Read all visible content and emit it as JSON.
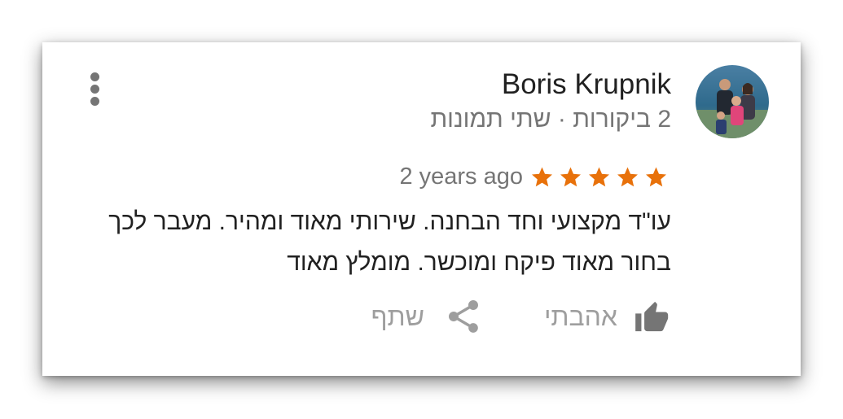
{
  "review": {
    "author_name": "Boris Krupnik",
    "author_meta": "2 ביקורות · שתי תמונות",
    "rating": 5,
    "rating_max": 5,
    "star_color": "#e8710a",
    "time_ago": "2 years ago",
    "text": "עו\"ד מקצועי וחד הבחנה. שירותי מאוד ומהיר. מעבר לכך בחור מאוד פיקח ומוכשר. מומלץ מאוד",
    "like_label": "אהבתי",
    "share_label": "שתף"
  },
  "icons": {
    "menu": "more-vert-icon",
    "like": "thumb-up-icon",
    "share": "share-icon",
    "star": "star-icon"
  }
}
